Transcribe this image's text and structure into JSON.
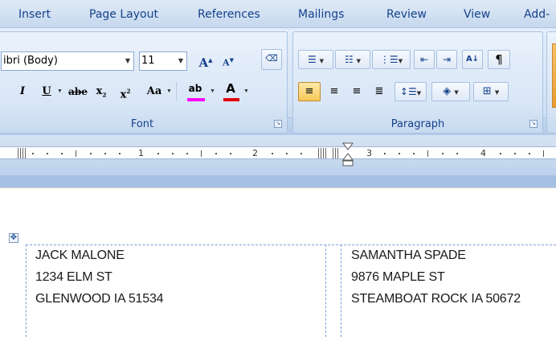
{
  "tabs": [
    "Insert",
    "Page Layout",
    "References",
    "Mailings",
    "Review",
    "View",
    "Add-"
  ],
  "font_group": {
    "font_name": "ibri (Body)",
    "font_size": "11",
    "grow_label": "A",
    "shrink_label": "A",
    "italic": "I",
    "underline": "U",
    "strike": "abe",
    "subscript": "x",
    "superscript": "x",
    "change_case": "Aa",
    "highlight": "ab",
    "font_color": "A",
    "label": "Font"
  },
  "paragraph_group": {
    "label": "Paragraph",
    "pilcrow": "¶",
    "sort": "A↓"
  },
  "ruler": {
    "numbers": [
      "1",
      "2",
      "3",
      "4"
    ]
  },
  "document": {
    "left_label": [
      "JACK MALONE",
      "1234 ELM ST",
      "GLENWOOD IA  51534"
    ],
    "right_label": [
      "SAMANTHA SPADE",
      "9876 MAPLE ST",
      "STEAMBOAT ROCK IA 50672"
    ]
  },
  "colors": {
    "accent": "#15428b",
    "highlight_bar": "#ff00ff",
    "font_color_bar": "#e00000",
    "gridline": "#7aa0d8"
  }
}
